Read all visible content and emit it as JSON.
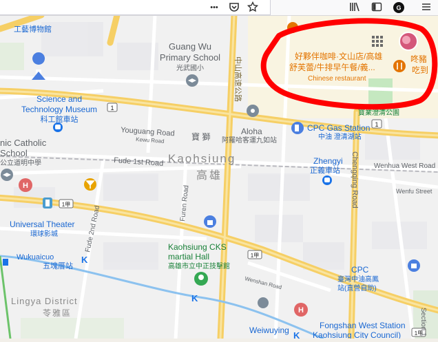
{
  "toolbar": {
    "icons": [
      "more-dots-icon",
      "pocket-icon",
      "bookmark-star-icon",
      "library-icon",
      "sidebar-icon",
      "extension-icon",
      "menu-icon"
    ],
    "more_label": "•••"
  },
  "map": {
    "labels": {
      "museum_zh_top": "工藝博物館",
      "guangwu_en_1": "Guang Wu",
      "guangwu_en_2": "Primary School",
      "guangwu_zh": "光武國小",
      "zhongshan_road": "中山高速公路",
      "science_1": "Science and",
      "science_2": "Technology Museum",
      "science_zh": "科工館車站",
      "youguang_road": "Youguang Road",
      "baoshi": "寶 獅",
      "kewu_road": "Kewu Road",
      "aloha": "Aloha",
      "aloha_zh": "阿羅哈客運九如站",
      "cpc_gas": "CPC Gas Station",
      "cpc_gas_zh": "中油 澄清湖站",
      "catholic": "nic Catholic",
      "school": "School",
      "school_zh": "公立道明中學",
      "fude_road": "Fude 1st Road",
      "kaohsiung": "Kaohsiung",
      "kaohsiung_zh": "高雄",
      "zhengyi": "Zhengyi",
      "zhengyi_zh": "正義車站",
      "chengqing_road": "Chengqing Road",
      "wenhua_road": "Wenhua West Road",
      "wenfu_street": "Wenfu Street",
      "furen_road": "Furen Road",
      "fude2_road": "Fude 2nd Road",
      "universal": "Universal Theater",
      "universal_zh": "環球影城",
      "cks_1": "Kaohsiung CKS",
      "cks_2": "martial Hall",
      "cks_zh": "高雄市立中正技擊館",
      "wukuaicuo": "Wukuaicuo",
      "wukuaicuo_zh": "五塊厝站",
      "wenshan_road": "Wenshan Road",
      "cpc_right": "CPC",
      "cpc_right_zh1": "臺灣中油高鳳",
      "cpc_right_zh2": "站(直營自助)",
      "lingya": "Lingya District",
      "lingya_zh": "苓雅區",
      "weiwuying": "Weiwuying",
      "fongshan_1": "Fongshan West Station",
      "fongshan_2": "Kaohsiung City Council)",
      "section": "Section 1",
      "restaurant_1": "好夥伴咖啡·文山店/高雄",
      "restaurant_2": "舒芙蕾/牛排早午餐/義...",
      "restaurant_type": "Chinese restaurant",
      "right_shop_1": "咚豬",
      "right_shop_2": "吃到",
      "park_zh": "寶業澄清公園",
      "shield_1": "1",
      "shield_1a": "1",
      "shield_1b": "1甲",
      "shield_1c": "1甲",
      "shield_1d": "1甲"
    }
  },
  "colors": {
    "highway": "#f6cf65",
    "annotation": "#ff0000",
    "poi_orange": "#e37400",
    "poi_blue": "#4b7fe0",
    "transit_blue": "#1a73e8"
  }
}
